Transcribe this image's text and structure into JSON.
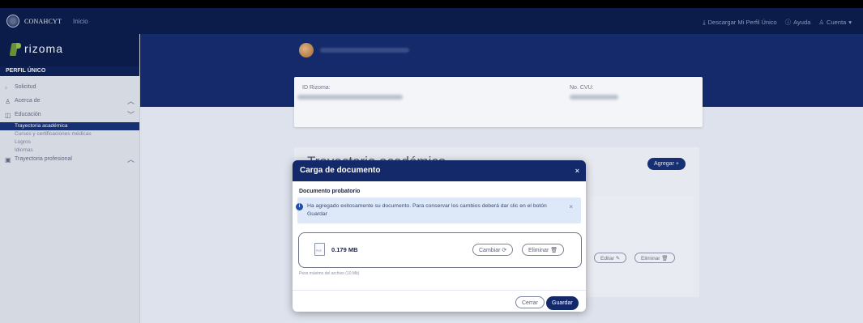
{
  "topbar": {
    "brand": "CONAHCYT",
    "inicio": "Inicio",
    "download": "Descargar Mi Perfil Único",
    "help": "Ayuda",
    "account": "Cuenta"
  },
  "sidebar": {
    "logo_text": "rizoma",
    "section_header": "PERFIL ÚNICO",
    "items": [
      {
        "label": "Solicitud",
        "icon": "circle-icon"
      },
      {
        "label": "Acerca de",
        "icon": "user-icon",
        "chevron": "^"
      },
      {
        "label": "Educación",
        "icon": "book-icon",
        "chevron": "v"
      }
    ],
    "sub_items": [
      {
        "label": "Trayectoria académica",
        "active": true
      },
      {
        "label": "Cursos y certificaciones médicas",
        "active": false
      },
      {
        "label": "Logros",
        "active": false
      },
      {
        "label": "Idiomas",
        "active": false
      }
    ],
    "last_item": {
      "label": "Trayectoria profesional",
      "icon": "id-badge-icon",
      "chevron": "^"
    }
  },
  "profile": {
    "id_label": "ID Rizoma:",
    "cvu_label": "No. CVU:"
  },
  "section": {
    "title": "Trayectoria académica",
    "add_button": "Agregar +",
    "edit_button": "Editar",
    "delete_button": "Eliminar"
  },
  "modal": {
    "title": "Carga de documento",
    "close": "×",
    "subtitle": "Documento probatorio",
    "alert_text": "Ha agregado exitosamente su documento. Para conservar los cambios deberá dar clic en el botón Guardar",
    "alert_close": "×",
    "file_icon_label": "PDF",
    "file_size": "0.179 MB",
    "change_button": "Cambiar",
    "remove_button": "Eliminar",
    "hint": "Peso máximo del archivo (10 Mb)",
    "close_button": "Cerrar",
    "save_button": "Guardar"
  },
  "colors": {
    "navy": "#0b1b4a",
    "hero": "#142a6b",
    "accent": "#14296a",
    "alert_bg": "#dde8f8"
  }
}
